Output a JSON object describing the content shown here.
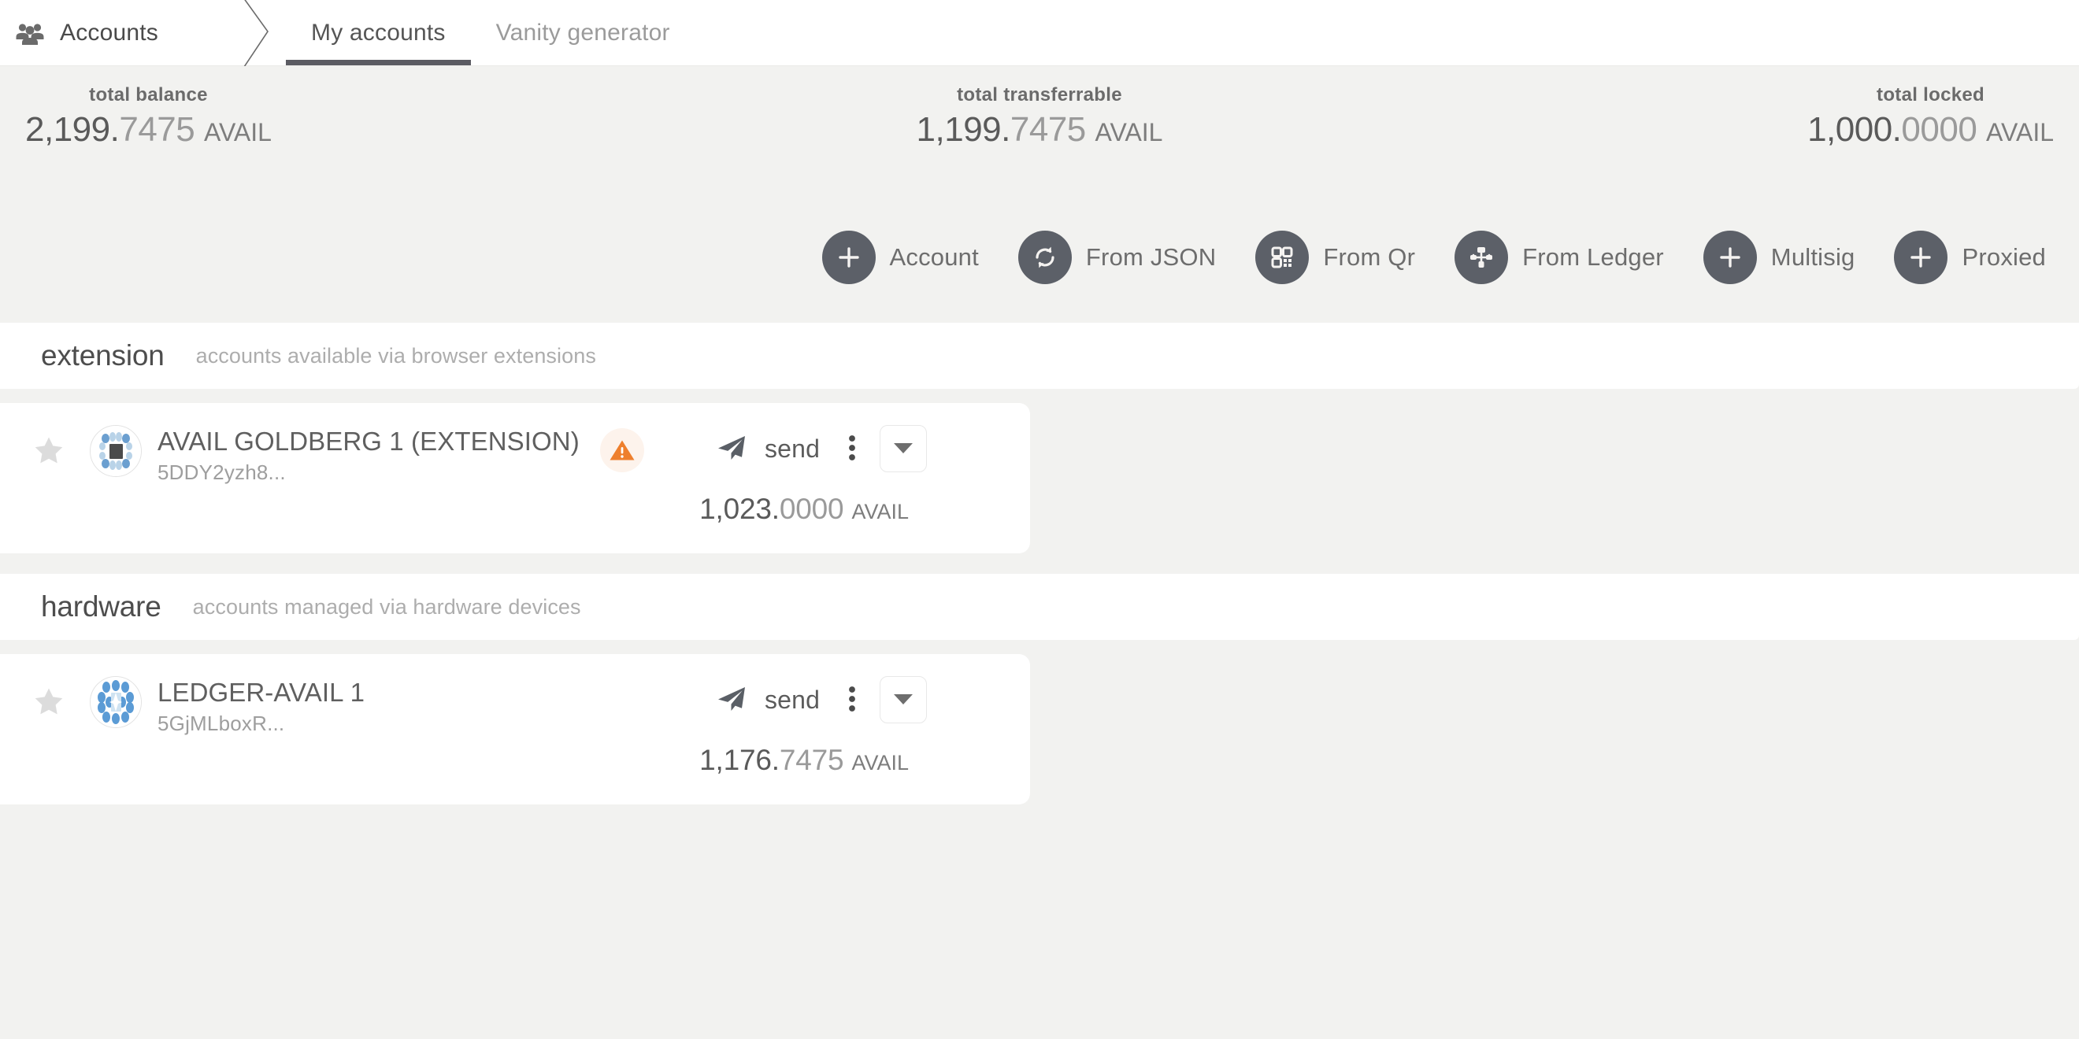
{
  "header": {
    "breadcrumb": {
      "icon": "users-group-icon",
      "label": "Accounts"
    },
    "tabs": [
      {
        "label": "My accounts",
        "active": true
      },
      {
        "label": "Vanity generator",
        "active": false
      }
    ]
  },
  "summary": [
    {
      "label": "total balance",
      "int": "2,199.",
      "dec": "7475",
      "unit": "AVAIL"
    },
    {
      "label": "total transferrable",
      "int": "1,199.",
      "dec": "7475",
      "unit": "AVAIL"
    },
    {
      "label": "total locked",
      "int": "1,000.",
      "dec": "0000",
      "unit": "AVAIL"
    }
  ],
  "actions": [
    {
      "label": "Account",
      "icon": "plus-icon"
    },
    {
      "label": "From JSON",
      "icon": "sync-icon"
    },
    {
      "label": "From Qr",
      "icon": "qr-code-icon"
    },
    {
      "label": "From Ledger",
      "icon": "sitemap-icon"
    },
    {
      "label": "Multisig",
      "icon": "plus-icon"
    },
    {
      "label": "Proxied",
      "icon": "plus-icon"
    }
  ],
  "sections": [
    {
      "title": "extension",
      "desc": "accounts available via browser extensions",
      "account": {
        "name": "AVAIL GOLDBERG 1 (EXTENSION)",
        "address": "5DDY2yzh8...",
        "warning": true,
        "send_label": "send",
        "balance_int": "1,023.",
        "balance_dec": "0000",
        "balance_unit": "AVAIL"
      }
    },
    {
      "title": "hardware",
      "desc": "accounts managed via hardware devices",
      "account": {
        "name": "LEDGER-AVAIL 1",
        "address": "5GjMLboxR...",
        "warning": false,
        "send_label": "send",
        "balance_int": "1,176.",
        "balance_dec": "7475",
        "balance_unit": "AVAIL"
      }
    }
  ],
  "colors": {
    "page_bg": "#f2f2f0",
    "card_bg": "#ffffff",
    "accent_dark": "#5c6068",
    "warning": "#ee7f2d",
    "text_primary": "#5a5a5a",
    "text_muted": "#9e9e9e"
  }
}
